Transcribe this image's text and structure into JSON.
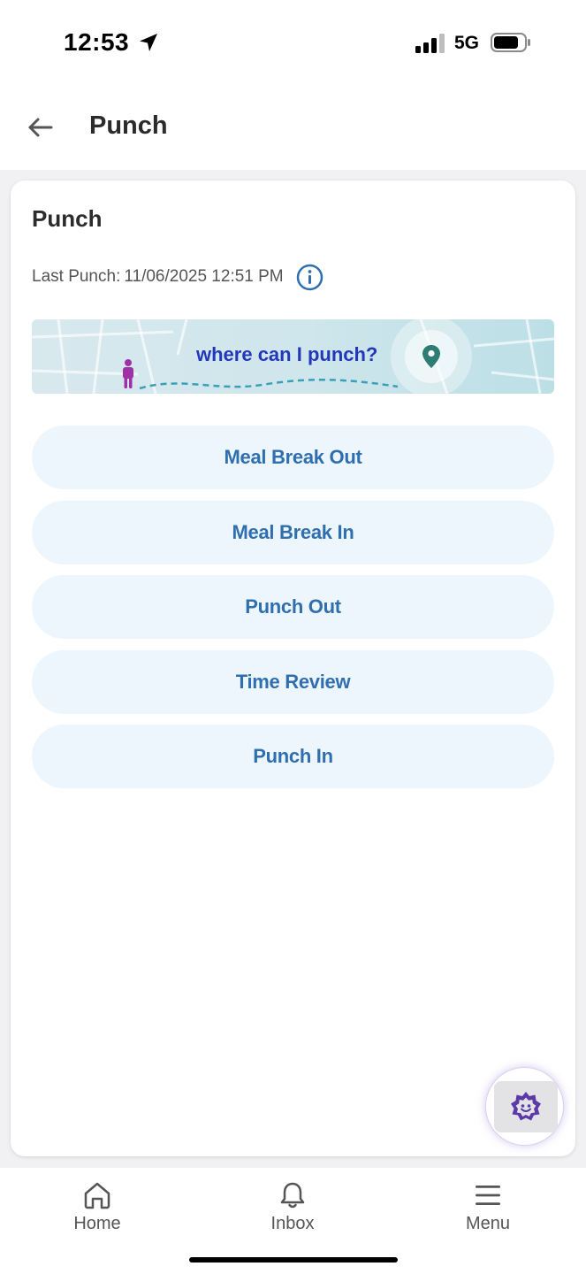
{
  "status_bar": {
    "time": "12:53",
    "network": "5G"
  },
  "header": {
    "title": "Punch"
  },
  "card": {
    "title": "Punch",
    "last_punch_label": "Last Punch:",
    "last_punch_value": "11/06/2025 12:51 PM",
    "map_banner_text": "where can I punch?"
  },
  "actions": [
    {
      "label": "Meal Break Out"
    },
    {
      "label": "Meal Break In"
    },
    {
      "label": "Punch Out"
    },
    {
      "label": "Time Review"
    },
    {
      "label": "Punch In"
    }
  ],
  "bottom_nav": {
    "items": [
      {
        "label": "Home",
        "icon": "home-icon"
      },
      {
        "label": "Inbox",
        "icon": "bell-icon"
      },
      {
        "label": "Menu",
        "icon": "hamburger-menu-icon"
      }
    ]
  },
  "colors": {
    "accent_text": "#2f6fb0",
    "button_bg": "#eef6fd",
    "map_link": "#2338b8",
    "assistant": "#5b3aa8"
  }
}
